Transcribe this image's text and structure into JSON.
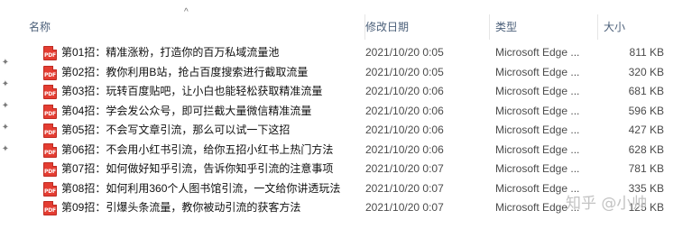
{
  "header": {
    "columns": {
      "name": "名称",
      "date": "修改日期",
      "type": "类型",
      "size": "大小"
    },
    "sort_indicator": "^"
  },
  "gutter_icon": "pin-icon",
  "file_icon": {
    "name": "pdf-file-icon",
    "text": "PDF",
    "color": "#e43d32"
  },
  "files": [
    {
      "name": "第01招：精准涨粉，打造你的百万私域流量池",
      "date": "2021/10/20 0:05",
      "type": "Microsoft Edge ...",
      "size": "811 KB"
    },
    {
      "name": "第02招：教你利用B站，抢占百度搜索进行截取流量",
      "date": "2021/10/20 0:05",
      "type": "Microsoft Edge ...",
      "size": "320 KB"
    },
    {
      "name": "第03招：玩转百度贴吧，让小白也能轻松获取精准流量",
      "date": "2021/10/20 0:06",
      "type": "Microsoft Edge ...",
      "size": "681 KB"
    },
    {
      "name": "第04招：学会发公众号，即可拦截大量微信精准流量",
      "date": "2021/10/20 0:06",
      "type": "Microsoft Edge ...",
      "size": "596 KB"
    },
    {
      "name": "第05招：不会写文章引流，那么可以试一下这招",
      "date": "2021/10/20 0:06",
      "type": "Microsoft Edge ...",
      "size": "427 KB"
    },
    {
      "name": "第06招：不会用小红书引流，给你五招小红书上热门方法",
      "date": "2021/10/20 0:06",
      "type": "Microsoft Edge ...",
      "size": "628 KB"
    },
    {
      "name": "第07招：如何做好知乎引流，告诉你知乎引流的注意事项",
      "date": "2021/10/20 0:07",
      "type": "Microsoft Edge ...",
      "size": "781 KB"
    },
    {
      "name": "第08招：如何利用360个人图书馆引流，一文给你讲透玩法",
      "date": "2021/10/20 0:07",
      "type": "Microsoft Edge ...",
      "size": "335 KB"
    },
    {
      "name": "第09招：引爆头条流量，教你被动引流的获客方法",
      "date": "2021/10/20 0:07",
      "type": "Microsoft Edge ...",
      "size": "125 KB"
    }
  ],
  "watermark": "知乎 @小帅"
}
